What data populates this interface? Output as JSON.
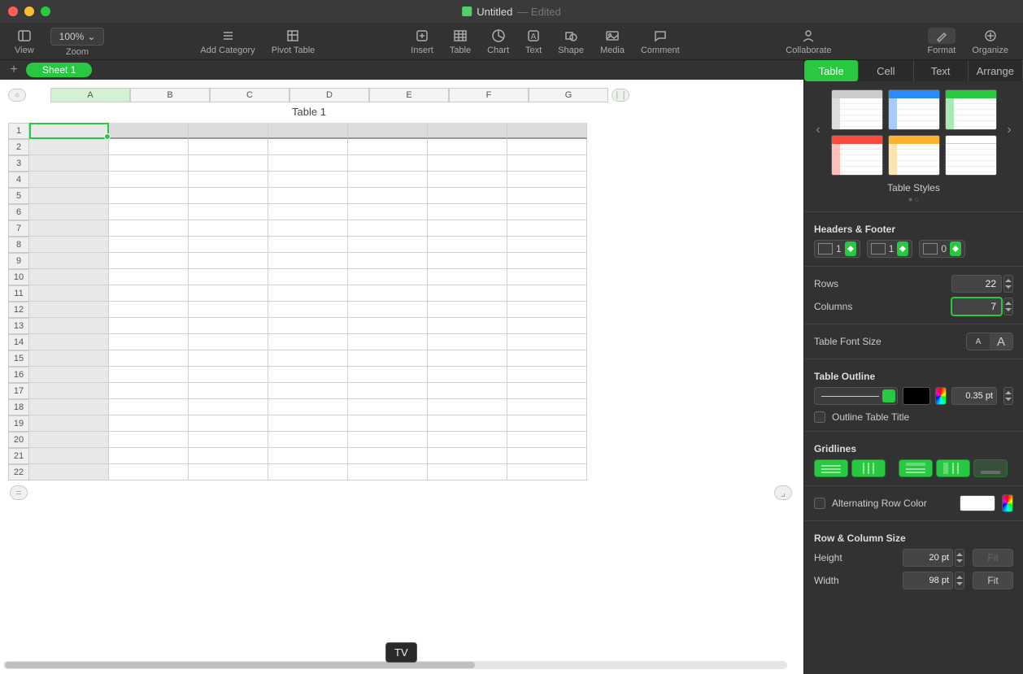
{
  "titlebar": {
    "name": "Untitled",
    "status": "— Edited"
  },
  "toolbar": {
    "view": "View",
    "zoom_value": "100%",
    "zoom_label": "Zoom",
    "add_category": "Add Category",
    "pivot": "Pivot Table",
    "insert": "Insert",
    "table": "Table",
    "chart": "Chart",
    "text": "Text",
    "shape": "Shape",
    "media": "Media",
    "comment": "Comment",
    "collaborate": "Collaborate",
    "format": "Format",
    "organize": "Organize"
  },
  "sheets": {
    "active": "Sheet 1"
  },
  "spreadsheet": {
    "title": "Table 1",
    "columns": [
      "A",
      "B",
      "C",
      "D",
      "E",
      "F",
      "G"
    ],
    "rows": [
      "1",
      "2",
      "3",
      "4",
      "5",
      "6",
      "7",
      "8",
      "9",
      "10",
      "11",
      "12",
      "13",
      "14",
      "15",
      "16",
      "17",
      "18",
      "19",
      "20",
      "21",
      "22"
    ],
    "selected": "A1"
  },
  "dock_tooltip": "TV",
  "inspector": {
    "tabs": {
      "table": "Table",
      "cell": "Cell",
      "text": "Text",
      "arrange": "Arrange"
    },
    "styles_caption": "Table Styles",
    "headers_footer": {
      "title": "Headers & Footer",
      "header_cols": "1",
      "header_rows": "1",
      "footer_rows": "0"
    },
    "rows": {
      "label": "Rows",
      "value": "22"
    },
    "columns": {
      "label": "Columns",
      "value": "7"
    },
    "font_size": {
      "label": "Table Font Size",
      "small": "A",
      "big": "A"
    },
    "outline": {
      "label": "Table Outline",
      "pt": "0.35 pt",
      "title_check": "Outline Table Title"
    },
    "gridlines": {
      "label": "Gridlines"
    },
    "altrow": {
      "label": "Alternating Row Color"
    },
    "rowcol_size": {
      "title": "Row & Column Size",
      "height_label": "Height",
      "height_val": "20 pt",
      "fit1": "Fit",
      "width_label": "Width",
      "width_val": "98 pt",
      "fit2": "Fit"
    }
  }
}
